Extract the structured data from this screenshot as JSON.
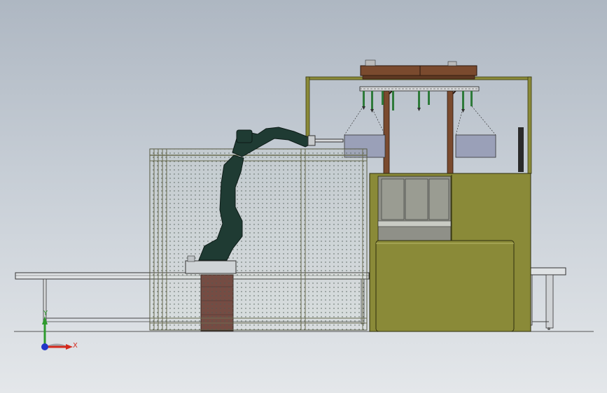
{
  "viewport": {
    "background_top": "#aeb7c2",
    "background_bottom": "#e4e7ea"
  },
  "triad": {
    "x_label": "X",
    "y_label": "Y",
    "x_color": "#d42a1e",
    "y_color": "#2e9b2e",
    "z_color": "#2236c8"
  },
  "model": {
    "robot_color": "#1f3b33",
    "cabinet_color": "#8a8a38",
    "frame_color": "#6e6a2a",
    "beam_color": "#7a4a2e",
    "pallet_color": "#6a3b34",
    "screen_color": "#9aa0b8"
  }
}
